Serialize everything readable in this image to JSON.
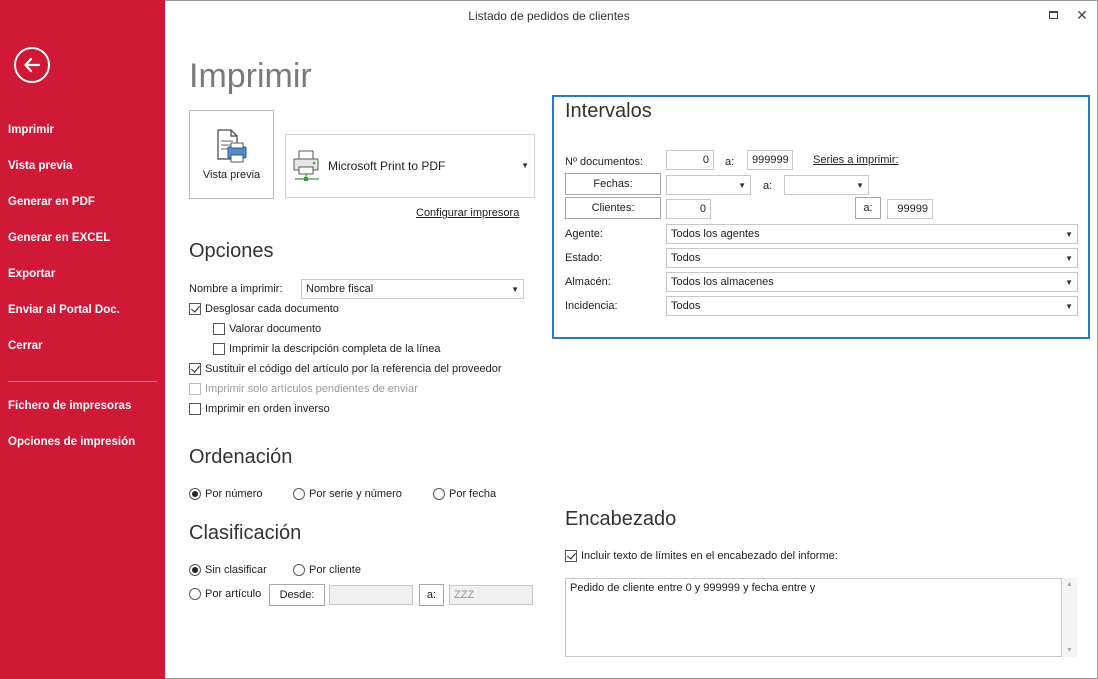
{
  "window": {
    "title": "Listado de pedidos de clientes"
  },
  "sidebar": {
    "items": [
      "Imprimir",
      "Vista previa",
      "Generar en PDF",
      "Generar en EXCEL",
      "Exportar",
      "Enviar al Portal Doc.",
      "Cerrar"
    ],
    "bottom_items": [
      "Fichero de impresoras",
      "Opciones de impresión"
    ]
  },
  "page": {
    "title": "Imprimir"
  },
  "print": {
    "preview_label": "Vista previa",
    "printer": "Microsoft Print to PDF",
    "configure_link": "Configurar impresora"
  },
  "options": {
    "title": "Opciones",
    "name_label": "Nombre a imprimir:",
    "name_value": "Nombre fiscal",
    "checkboxes": [
      {
        "label": "Desglosar cada documento",
        "checked": true,
        "enabled": true
      },
      {
        "label": "Valorar documento",
        "checked": false,
        "enabled": true
      },
      {
        "label": "Imprimir la descripción completa de la línea",
        "checked": false,
        "enabled": true
      },
      {
        "label": "Sustituir el código del artículo por la referencia del proveedor",
        "checked": true,
        "enabled": true
      },
      {
        "label": "Imprimir solo artículos pendientes de enviar",
        "checked": false,
        "enabled": false
      },
      {
        "label": "Imprimir en orden inverso",
        "checked": false,
        "enabled": true
      }
    ]
  },
  "ordering": {
    "title": "Ordenación",
    "options": [
      "Por número",
      "Por serie y número",
      "Por fecha"
    ],
    "selected": "Por número"
  },
  "classification": {
    "title": "Clasificación",
    "options": [
      "Sin clasificar",
      "Por cliente",
      "Por artículo"
    ],
    "selected": "Sin clasificar",
    "from_label": "Desde:",
    "from_value": "",
    "to_label": "a:",
    "to_value": "ZZZ"
  },
  "intervals": {
    "title": "Intervalos",
    "documents_label": "Nº documentos:",
    "documents_from": "0",
    "a_label": "a:",
    "documents_to": "999999",
    "series_link": "Series a imprimir:",
    "dates_label": "Fechas:",
    "date_from": "",
    "date_to": "",
    "clients_label": "Clientes:",
    "clients_from": "0",
    "clients_to": "99999",
    "agent_label": "Agente:",
    "agent_value": "Todos los agentes",
    "status_label": "Estado:",
    "status_value": "Todos",
    "warehouse_label": "Almacén:",
    "warehouse_value": "Todos los almacenes",
    "incident_label": "Incidencia:",
    "incident_value": "Todos"
  },
  "header": {
    "title": "Encabezado",
    "include_label": "Incluir texto de límites en el encabezado del informe:",
    "include_checked": true,
    "text": "Pedido de cliente entre 0 y 999999 y fecha entre  y"
  },
  "colors": {
    "sidebar": "#d01837",
    "panel_border": "#2b79c2"
  },
  "icons": {
    "back": "back-arrow-icon",
    "preview": "document-preview-icon",
    "printer": "printer-icon",
    "maximize": "maximize-icon",
    "close": "close-icon"
  }
}
